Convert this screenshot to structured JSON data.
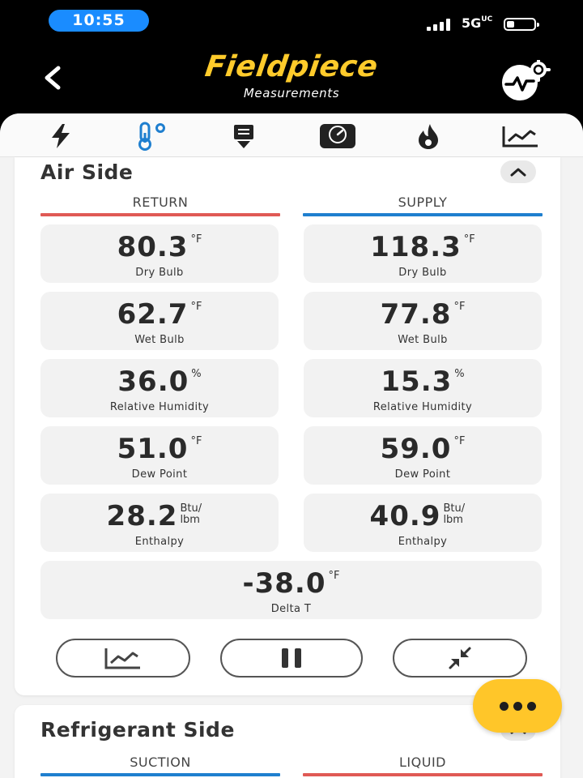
{
  "status_bar": {
    "time": "10:55",
    "network": "5G",
    "network_sup": "UC"
  },
  "header": {
    "brand": "Fieldpiece",
    "subtitle": "Measurements"
  },
  "tabs": [
    {
      "icon": "lightning-icon"
    },
    {
      "icon": "thermometer-icon",
      "active": true
    },
    {
      "icon": "airflow-icon"
    },
    {
      "icon": "gauge-icon"
    },
    {
      "icon": "flame-icon"
    },
    {
      "icon": "trend-chart-icon"
    }
  ],
  "air_side": {
    "title": "Air Side",
    "return_label": "RETURN",
    "supply_label": "SUPPLY",
    "return_color": "#e05a55",
    "supply_color": "#1f7fcf",
    "return": [
      {
        "value": "80.3",
        "unit": "°F",
        "label": "Dry Bulb"
      },
      {
        "value": "62.7",
        "unit": "°F",
        "label": "Wet Bulb"
      },
      {
        "value": "36.0",
        "unit": "%",
        "label": "Relative Humidity"
      },
      {
        "value": "51.0",
        "unit": "°F",
        "label": "Dew Point"
      },
      {
        "value": "28.2",
        "unit": "Btu/ lbm",
        "label": "Enthalpy"
      }
    ],
    "supply": [
      {
        "value": "118.3",
        "unit": "°F",
        "label": "Dry Bulb"
      },
      {
        "value": "77.8",
        "unit": "°F",
        "label": "Wet Bulb"
      },
      {
        "value": "15.3",
        "unit": "%",
        "label": "Relative Humidity"
      },
      {
        "value": "59.0",
        "unit": "°F",
        "label": "Dew Point"
      },
      {
        "value": "40.9",
        "unit": "Btu/ lbm",
        "label": "Enthalpy"
      }
    ],
    "delta": {
      "value": "-38.0",
      "unit": "°F",
      "label": "Delta T"
    }
  },
  "refrigerant_side": {
    "title": "Refrigerant Side",
    "suction_label": "SUCTION",
    "liquid_label": "LIQUID",
    "suction_color": "#1f7fcf",
    "liquid_color": "#e05a55"
  },
  "accent_color": "#ffc629"
}
